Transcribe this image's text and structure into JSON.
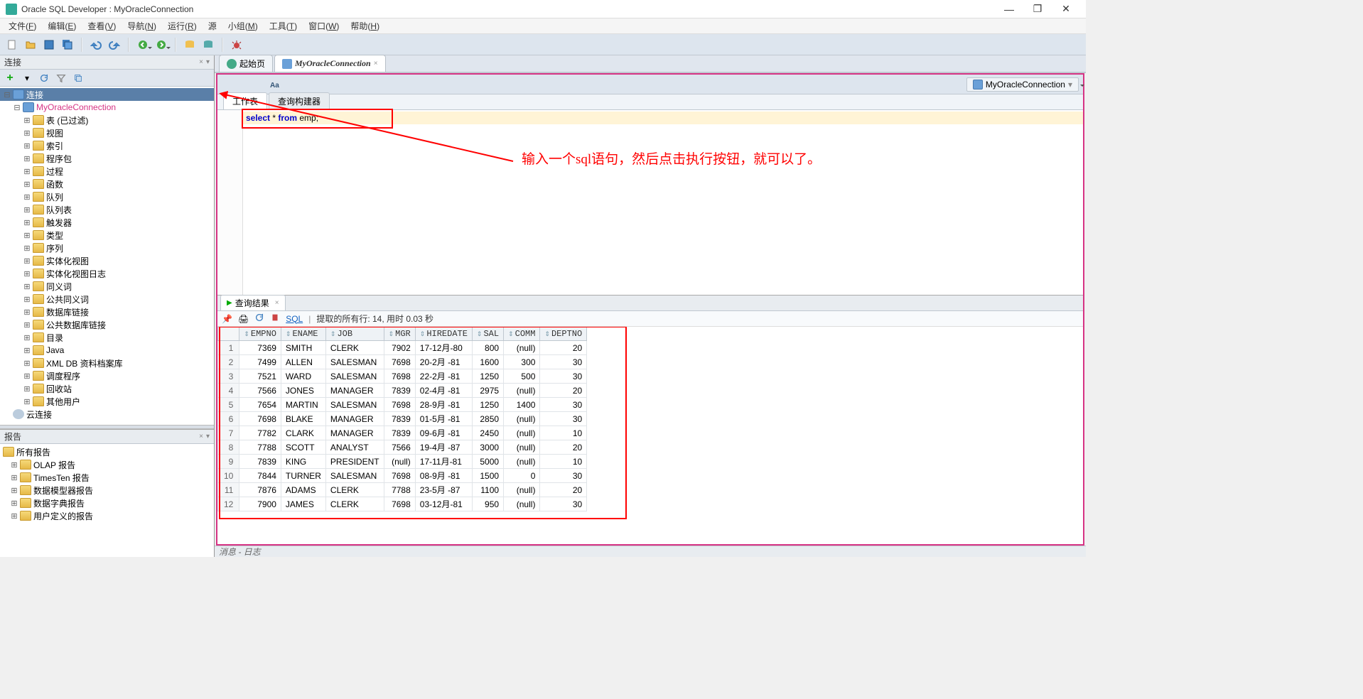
{
  "window": {
    "title": "Oracle SQL Developer : MyOracleConnection"
  },
  "menu": [
    "文件(F)",
    "编辑(E)",
    "查看(V)",
    "导航(N)",
    "运行(R)",
    "源",
    "小组(M)",
    "工具(T)",
    "窗口(W)",
    "帮助(H)"
  ],
  "left_panel": {
    "title": "连接",
    "conn_root": "连接",
    "connection": "MyOracleConnection",
    "nodes": [
      "表 (已过滤)",
      "视图",
      "索引",
      "程序包",
      "过程",
      "函数",
      "队列",
      "队列表",
      "触发器",
      "类型",
      "序列",
      "实体化视图",
      "实体化视图日志",
      "同义词",
      "公共同义词",
      "数据库链接",
      "公共数据库链接",
      "目录",
      "Java",
      "XML DB 资料档案库",
      "调度程序",
      "回收站",
      "其他用户"
    ],
    "cloud": "云连接"
  },
  "reports_panel": {
    "title": "报告",
    "root": "所有报告",
    "items": [
      "OLAP 报告",
      "TimesTen 报告",
      "数据模型器报告",
      "数据字典报告",
      "用户定义的报告"
    ]
  },
  "tabs": {
    "start": "起始页",
    "connection": "MyOracleConnection"
  },
  "worksheet_tabs": {
    "ws": "工作表",
    "qb": "查询构建器"
  },
  "sql": {
    "kw_select": "select",
    "star": " * ",
    "kw_from": "from",
    "rest": " emp;"
  },
  "right_conn_label": "MyOracleConnection",
  "annotation": "输入一个sql语句，然后点击执行按钮，就可以了。",
  "results": {
    "tab_label": "查询结果",
    "sql_link": "SQL",
    "status_label": "提取的所有行: 14, 用时 0.03 秒",
    "columns": [
      "EMPNO",
      "ENAME",
      "JOB",
      "MGR",
      "HIREDATE",
      "SAL",
      "COMM",
      "DEPTNO"
    ],
    "rows": [
      [
        "7369",
        "SMITH",
        "CLERK",
        "7902",
        "17-12月-80",
        "800",
        "(null)",
        "20"
      ],
      [
        "7499",
        "ALLEN",
        "SALESMAN",
        "7698",
        "20-2月 -81",
        "1600",
        "300",
        "30"
      ],
      [
        "7521",
        "WARD",
        "SALESMAN",
        "7698",
        "22-2月 -81",
        "1250",
        "500",
        "30"
      ],
      [
        "7566",
        "JONES",
        "MANAGER",
        "7839",
        "02-4月 -81",
        "2975",
        "(null)",
        "20"
      ],
      [
        "7654",
        "MARTIN",
        "SALESMAN",
        "7698",
        "28-9月 -81",
        "1250",
        "1400",
        "30"
      ],
      [
        "7698",
        "BLAKE",
        "MANAGER",
        "7839",
        "01-5月 -81",
        "2850",
        "(null)",
        "30"
      ],
      [
        "7782",
        "CLARK",
        "MANAGER",
        "7839",
        "09-6月 -81",
        "2450",
        "(null)",
        "10"
      ],
      [
        "7788",
        "SCOTT",
        "ANALYST",
        "7566",
        "19-4月 -87",
        "3000",
        "(null)",
        "20"
      ],
      [
        "7839",
        "KING",
        "PRESIDENT",
        "(null)",
        "17-11月-81",
        "5000",
        "(null)",
        "10"
      ],
      [
        "7844",
        "TURNER",
        "SALESMAN",
        "7698",
        "08-9月 -81",
        "1500",
        "0",
        "30"
      ],
      [
        "7876",
        "ADAMS",
        "CLERK",
        "7788",
        "23-5月 -87",
        "1100",
        "(null)",
        "20"
      ],
      [
        "7900",
        "JAMES",
        "CLERK",
        "7698",
        "03-12月-81",
        "950",
        "(null)",
        "30"
      ]
    ]
  },
  "bottom_status": "消息 - 日志"
}
